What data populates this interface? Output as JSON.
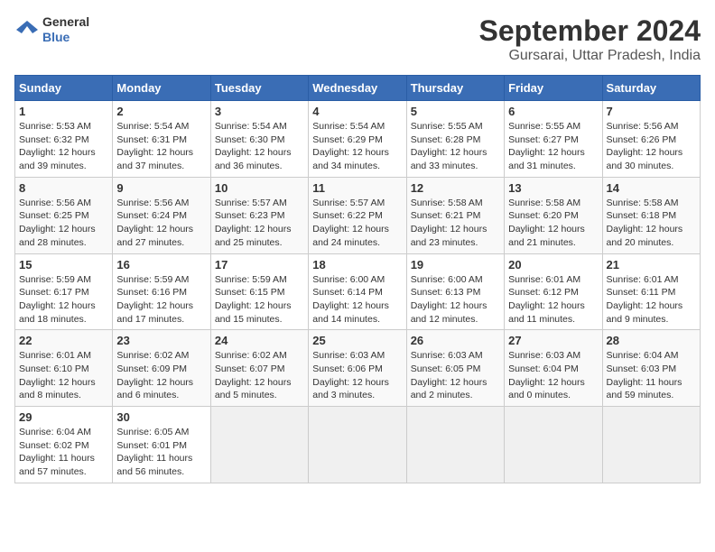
{
  "header": {
    "logo_line1": "General",
    "logo_line2": "Blue",
    "title": "September 2024",
    "subtitle": "Gursarai, Uttar Pradesh, India"
  },
  "days_of_week": [
    "Sunday",
    "Monday",
    "Tuesday",
    "Wednesday",
    "Thursday",
    "Friday",
    "Saturday"
  ],
  "weeks": [
    [
      {
        "day": "1",
        "info": "Sunrise: 5:53 AM\nSunset: 6:32 PM\nDaylight: 12 hours\nand 39 minutes."
      },
      {
        "day": "2",
        "info": "Sunrise: 5:54 AM\nSunset: 6:31 PM\nDaylight: 12 hours\nand 37 minutes."
      },
      {
        "day": "3",
        "info": "Sunrise: 5:54 AM\nSunset: 6:30 PM\nDaylight: 12 hours\nand 36 minutes."
      },
      {
        "day": "4",
        "info": "Sunrise: 5:54 AM\nSunset: 6:29 PM\nDaylight: 12 hours\nand 34 minutes."
      },
      {
        "day": "5",
        "info": "Sunrise: 5:55 AM\nSunset: 6:28 PM\nDaylight: 12 hours\nand 33 minutes."
      },
      {
        "day": "6",
        "info": "Sunrise: 5:55 AM\nSunset: 6:27 PM\nDaylight: 12 hours\nand 31 minutes."
      },
      {
        "day": "7",
        "info": "Sunrise: 5:56 AM\nSunset: 6:26 PM\nDaylight: 12 hours\nand 30 minutes."
      }
    ],
    [
      {
        "day": "8",
        "info": "Sunrise: 5:56 AM\nSunset: 6:25 PM\nDaylight: 12 hours\nand 28 minutes."
      },
      {
        "day": "9",
        "info": "Sunrise: 5:56 AM\nSunset: 6:24 PM\nDaylight: 12 hours\nand 27 minutes."
      },
      {
        "day": "10",
        "info": "Sunrise: 5:57 AM\nSunset: 6:23 PM\nDaylight: 12 hours\nand 25 minutes."
      },
      {
        "day": "11",
        "info": "Sunrise: 5:57 AM\nSunset: 6:22 PM\nDaylight: 12 hours\nand 24 minutes."
      },
      {
        "day": "12",
        "info": "Sunrise: 5:58 AM\nSunset: 6:21 PM\nDaylight: 12 hours\nand 23 minutes."
      },
      {
        "day": "13",
        "info": "Sunrise: 5:58 AM\nSunset: 6:20 PM\nDaylight: 12 hours\nand 21 minutes."
      },
      {
        "day": "14",
        "info": "Sunrise: 5:58 AM\nSunset: 6:18 PM\nDaylight: 12 hours\nand 20 minutes."
      }
    ],
    [
      {
        "day": "15",
        "info": "Sunrise: 5:59 AM\nSunset: 6:17 PM\nDaylight: 12 hours\nand 18 minutes."
      },
      {
        "day": "16",
        "info": "Sunrise: 5:59 AM\nSunset: 6:16 PM\nDaylight: 12 hours\nand 17 minutes."
      },
      {
        "day": "17",
        "info": "Sunrise: 5:59 AM\nSunset: 6:15 PM\nDaylight: 12 hours\nand 15 minutes."
      },
      {
        "day": "18",
        "info": "Sunrise: 6:00 AM\nSunset: 6:14 PM\nDaylight: 12 hours\nand 14 minutes."
      },
      {
        "day": "19",
        "info": "Sunrise: 6:00 AM\nSunset: 6:13 PM\nDaylight: 12 hours\nand 12 minutes."
      },
      {
        "day": "20",
        "info": "Sunrise: 6:01 AM\nSunset: 6:12 PM\nDaylight: 12 hours\nand 11 minutes."
      },
      {
        "day": "21",
        "info": "Sunrise: 6:01 AM\nSunset: 6:11 PM\nDaylight: 12 hours\nand 9 minutes."
      }
    ],
    [
      {
        "day": "22",
        "info": "Sunrise: 6:01 AM\nSunset: 6:10 PM\nDaylight: 12 hours\nand 8 minutes."
      },
      {
        "day": "23",
        "info": "Sunrise: 6:02 AM\nSunset: 6:09 PM\nDaylight: 12 hours\nand 6 minutes."
      },
      {
        "day": "24",
        "info": "Sunrise: 6:02 AM\nSunset: 6:07 PM\nDaylight: 12 hours\nand 5 minutes."
      },
      {
        "day": "25",
        "info": "Sunrise: 6:03 AM\nSunset: 6:06 PM\nDaylight: 12 hours\nand 3 minutes."
      },
      {
        "day": "26",
        "info": "Sunrise: 6:03 AM\nSunset: 6:05 PM\nDaylight: 12 hours\nand 2 minutes."
      },
      {
        "day": "27",
        "info": "Sunrise: 6:03 AM\nSunset: 6:04 PM\nDaylight: 12 hours\nand 0 minutes."
      },
      {
        "day": "28",
        "info": "Sunrise: 6:04 AM\nSunset: 6:03 PM\nDaylight: 11 hours\nand 59 minutes."
      }
    ],
    [
      {
        "day": "29",
        "info": "Sunrise: 6:04 AM\nSunset: 6:02 PM\nDaylight: 11 hours\nand 57 minutes."
      },
      {
        "day": "30",
        "info": "Sunrise: 6:05 AM\nSunset: 6:01 PM\nDaylight: 11 hours\nand 56 minutes."
      },
      {
        "day": "",
        "info": ""
      },
      {
        "day": "",
        "info": ""
      },
      {
        "day": "",
        "info": ""
      },
      {
        "day": "",
        "info": ""
      },
      {
        "day": "",
        "info": ""
      }
    ]
  ]
}
